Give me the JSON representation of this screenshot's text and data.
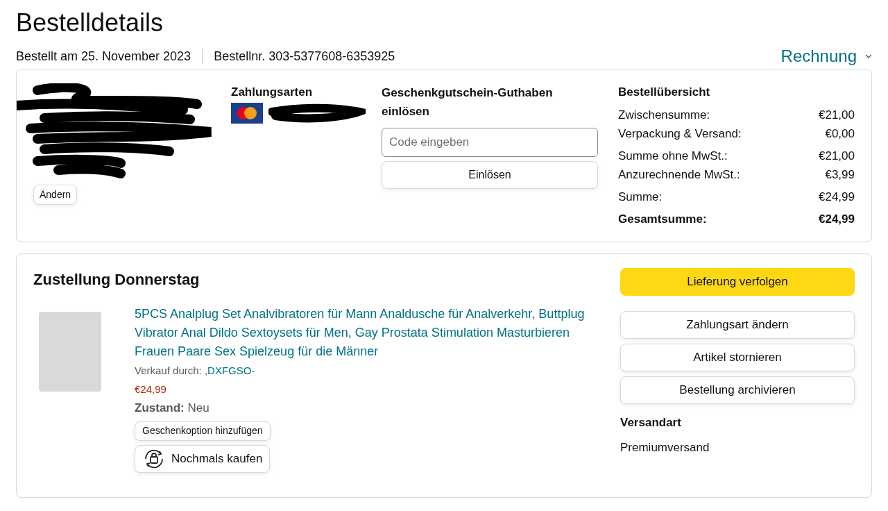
{
  "page_title": "Bestelldetails",
  "order_date": "Bestellt am 25. November 2023",
  "order_number": "Bestellnr. 303-5377608-6353925",
  "invoice_link": "Rechnung",
  "address": {
    "change_button": "Ändern"
  },
  "payment": {
    "heading": "Zahlungsarten"
  },
  "gift_card": {
    "heading": "Geschenkgutschein-Guthaben einlösen",
    "placeholder": "Code eingeben",
    "button": "Einlösen"
  },
  "summary": {
    "heading": "Bestellübersicht",
    "rows": [
      {
        "label": "Zwischensumme:",
        "value": "€21,00",
        "kind": "normal"
      },
      {
        "label": "Verpackung & Versand:",
        "value": "€0,00",
        "kind": "normal"
      },
      {
        "label": "Summe ohne MwSt.:",
        "value": "€21,00",
        "kind": "normal"
      },
      {
        "label": "Anzurechnende MwSt.:",
        "value": "€3,99",
        "kind": "normal"
      },
      {
        "label": "Summe:",
        "value": "€24,99",
        "kind": "normal"
      },
      {
        "label": "Gesamtsumme:",
        "value": "€24,99",
        "kind": "total"
      }
    ]
  },
  "delivery": {
    "heading": "Zustellung Donnerstag",
    "item": {
      "title": "5PCS Analplug Set Analvibratoren für Mann Analdusche für Analverkehr, Buttplug Vibrator Anal Dildo Sextoysets für Men, Gay Prostata Stimulation Masturbieren Frauen Paare Sex Spielzeug für die Männer",
      "seller_label": "Verkauf durch:",
      "seller": ",DXFGSO-",
      "price": "€24,99",
      "condition_label": "Zustand:",
      "condition": "Neu",
      "gift_button": "Geschenkoption hinzufügen",
      "buy_again_button": "Nochmals kaufen"
    },
    "primary_action": "Lieferung verfolgen",
    "actions": [
      "Zahlungsart ändern",
      "Artikel stornieren",
      "Bestellung archivieren"
    ],
    "shipping_heading": "Versandart",
    "shipping_method": "Premiumversand"
  }
}
